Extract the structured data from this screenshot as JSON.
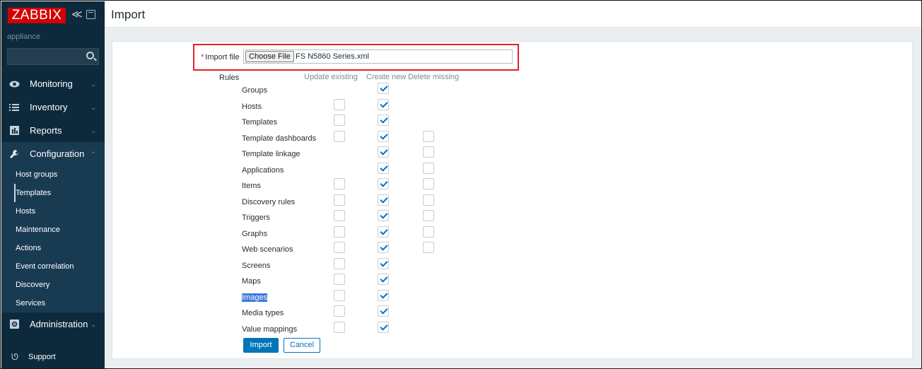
{
  "sidebar": {
    "logo": "ZABBIX",
    "collapse_glyph": "≪",
    "server_name": "appliance",
    "search": {
      "value": "",
      "placeholder": ""
    },
    "menu": [
      {
        "label": "Monitoring",
        "icon": "eye-icon"
      },
      {
        "label": "Inventory",
        "icon": "list-icon"
      },
      {
        "label": "Reports",
        "icon": "bar-chart-icon"
      },
      {
        "label": "Configuration",
        "icon": "wrench-icon"
      },
      {
        "label": "Administration",
        "icon": "gear-icon"
      }
    ],
    "configuration_items": [
      "Host groups",
      "Templates",
      "Hosts",
      "Maintenance",
      "Actions",
      "Event correlation",
      "Discovery",
      "Services"
    ],
    "selected_item": "Templates",
    "support_label": "Support"
  },
  "header": {
    "title": "Import"
  },
  "form": {
    "import_file_label": "Import file",
    "required_mark": "*",
    "choose_file_label": "Choose File",
    "file_name": "FS N5860 Series.xml",
    "rules_label": "Rules",
    "columns": [
      "Update existing",
      "Create new",
      "Delete missing"
    ],
    "rules": [
      {
        "name": "Groups",
        "update": null,
        "create": true,
        "delete": null
      },
      {
        "name": "Hosts",
        "update": false,
        "create": true,
        "delete": null
      },
      {
        "name": "Templates",
        "update": false,
        "create": true,
        "delete": null
      },
      {
        "name": "Template dashboards",
        "update": false,
        "create": true,
        "delete": false
      },
      {
        "name": "Template linkage",
        "update": null,
        "create": true,
        "delete": false
      },
      {
        "name": "Applications",
        "update": null,
        "create": true,
        "delete": false
      },
      {
        "name": "Items",
        "update": false,
        "create": true,
        "delete": false
      },
      {
        "name": "Discovery rules",
        "update": false,
        "create": true,
        "delete": false
      },
      {
        "name": "Triggers",
        "update": false,
        "create": true,
        "delete": false
      },
      {
        "name": "Graphs",
        "update": false,
        "create": true,
        "delete": false
      },
      {
        "name": "Web scenarios",
        "update": false,
        "create": true,
        "delete": false
      },
      {
        "name": "Screens",
        "update": false,
        "create": true,
        "delete": null
      },
      {
        "name": "Maps",
        "update": false,
        "create": true,
        "delete": null
      },
      {
        "name": "Images",
        "update": false,
        "create": true,
        "delete": null,
        "highlighted": true
      },
      {
        "name": "Media types",
        "update": false,
        "create": true,
        "delete": null
      },
      {
        "name": "Value mappings",
        "update": false,
        "create": true,
        "delete": null
      }
    ],
    "import_button": "Import",
    "cancel_button": "Cancel"
  },
  "colors": {
    "brand_red": "#d40000",
    "sidebar_bg": "#0d2a3d",
    "accent_blue": "#0275b8",
    "highlight_border": "#e0212b"
  }
}
